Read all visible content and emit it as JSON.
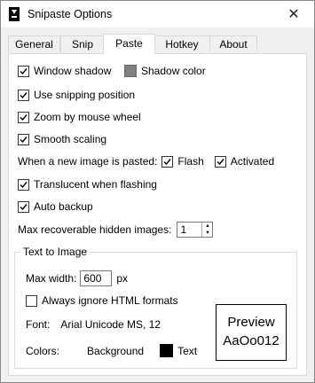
{
  "window": {
    "title": "Snipaste Options",
    "close_glyph": "✕",
    "app_icon": "snipaste-icon"
  },
  "tabs": [
    {
      "label": "General",
      "active": false
    },
    {
      "label": "Snip",
      "active": false
    },
    {
      "label": "Paste",
      "active": true
    },
    {
      "label": "Hotkey",
      "active": false
    },
    {
      "label": "About",
      "active": false
    }
  ],
  "paste": {
    "window_shadow": {
      "label": "Window shadow",
      "checked": true
    },
    "shadow_color": {
      "label": "Shadow color",
      "color": "#7f7f7f"
    },
    "use_snipping_position": {
      "label": "Use snipping position",
      "checked": true
    },
    "zoom_by_mouse_wheel": {
      "label": "Zoom by mouse wheel",
      "checked": true
    },
    "smooth_scaling": {
      "label": "Smooth scaling",
      "checked": true
    },
    "new_image_label": "When a new image is pasted:",
    "flash": {
      "label": "Flash",
      "checked": true
    },
    "activated": {
      "label": "Activated",
      "checked": true
    },
    "translucent_when_flashing": {
      "label": "Translucent when flashing",
      "checked": true
    },
    "auto_backup": {
      "label": "Auto backup",
      "checked": true
    },
    "max_hidden": {
      "label": "Max recoverable hidden images:",
      "value": "1"
    }
  },
  "text_to_image": {
    "group_title": "Text to Image",
    "max_width_label": "Max width:",
    "max_width_value": "600",
    "max_width_unit": "px",
    "ignore_html": {
      "label": "Always ignore HTML formats",
      "checked": false
    },
    "font_label": "Font:",
    "font_value": "Arial Unicode MS, 12",
    "colors_label": "Colors:",
    "background_label": "Background",
    "text_label": "Text",
    "text_color": "#000000",
    "preview_line1": "Preview",
    "preview_line2": "AaOo012"
  }
}
